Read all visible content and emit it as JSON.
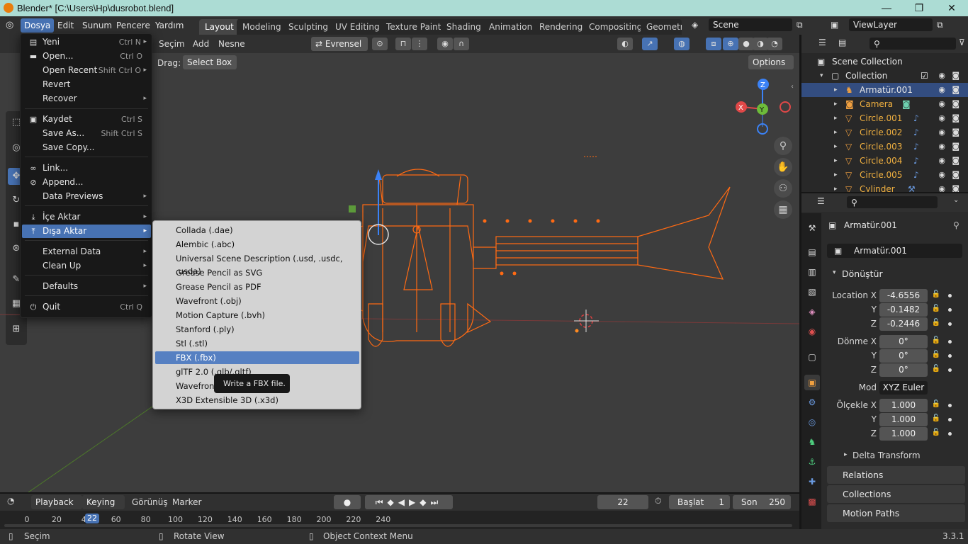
{
  "window": {
    "title": "Blender* [C:\\Users\\Hp\\dusrobot.blend]"
  },
  "menubar": {
    "items": [
      "Dosya",
      "Edit",
      "Sunum",
      "Pencere",
      "Yardım"
    ]
  },
  "workspaces": [
    "Layout",
    "Modeling",
    "Sculpting",
    "UV Editing",
    "Texture Paint",
    "Shading",
    "Animation",
    "Rendering",
    "Compositing",
    "Geometry"
  ],
  "scene": {
    "name": "Scene",
    "view_layer": "ViewLayer"
  },
  "viewport": {
    "header": {
      "menus": [
        "Seçim",
        "Add",
        "Nesne"
      ],
      "orientation": "Evrensel"
    },
    "drag_label": "Drag:",
    "drag_value": "Select Box",
    "options_label": "Options",
    "gizmo": {
      "x": "X",
      "y": "Y",
      "z": "Z"
    }
  },
  "file_menu": {
    "items": [
      {
        "label": "Yeni",
        "shortcut": "Ctrl N",
        "icon": "new-file-icon",
        "arrow": true
      },
      {
        "label": "Open...",
        "shortcut": "Ctrl O",
        "icon": "folder-icon"
      },
      {
        "label": "Open Recent",
        "shortcut": "Shift Ctrl O",
        "arrow": true
      },
      {
        "label": "Revert"
      },
      {
        "label": "Recover",
        "arrow": true
      },
      {
        "label": "Kaydet",
        "shortcut": "Ctrl S",
        "icon": "save-icon"
      },
      {
        "label": "Save As...",
        "shortcut": "Shift Ctrl S"
      },
      {
        "label": "Save Copy..."
      },
      {
        "label": "Link...",
        "icon": "link-icon"
      },
      {
        "label": "Append...",
        "icon": "append-icon"
      },
      {
        "label": "Data Previews",
        "arrow": true
      },
      {
        "label": "İçe Aktar",
        "icon": "import-icon",
        "arrow": true
      },
      {
        "label": "Dışa Aktar",
        "icon": "export-icon",
        "arrow": true
      },
      {
        "label": "External Data",
        "arrow": true
      },
      {
        "label": "Clean Up",
        "arrow": true
      },
      {
        "label": "Defaults",
        "arrow": true
      },
      {
        "label": "Quit",
        "shortcut": "Ctrl Q",
        "icon": "power-icon"
      }
    ]
  },
  "export_menu": {
    "items": [
      "Collada (.dae)",
      "Alembic (.abc)",
      "Universal Scene Description (.usd, .usdc, .usda)",
      "Grease Pencil as SVG",
      "Grease Pencil as PDF",
      "Wavefront (.obj)",
      "Motion Capture (.bvh)",
      "Stanford (.ply)",
      "Stl (.stl)",
      "FBX (.fbx)",
      "glTF 2.0 (.glb/.gltf)",
      "Wavefront (.obj)",
      "X3D Extensible 3D (.x3d)"
    ],
    "tooltip": "Write a FBX file."
  },
  "outliner": {
    "scene_collection": "Scene Collection",
    "collection": "Collection",
    "objects": [
      "Armatür.001",
      "Camera",
      "Circle.001",
      "Circle.002",
      "Circle.003",
      "Circle.004",
      "Circle.005",
      "Cylinder"
    ]
  },
  "properties": {
    "object_name": "Armatür.001",
    "object_field": "Armatür.001",
    "transform_header": "Dönüştür",
    "location_label": "Location X",
    "rotation_label": "Dönme X",
    "scale_label": "Ölçekle X",
    "y_label": "Y",
    "z_label": "Z",
    "location": [
      "-4.6556",
      "-0.1482",
      "-0.2446"
    ],
    "rotation": [
      "0°",
      "0°",
      "0°"
    ],
    "mode_label": "Mod",
    "mode": "XYZ Euler",
    "scale": [
      "1.000",
      "1.000",
      "1.000"
    ],
    "delta": "Delta Transform",
    "panels": [
      "Relations",
      "Collections",
      "Motion Paths"
    ]
  },
  "timeline": {
    "menus": [
      "Playback",
      "Keying",
      "Görünüş",
      "Marker"
    ],
    "current_frame": "22",
    "start_label": "Başlat",
    "start": "1",
    "end_label": "Son",
    "end": "250",
    "ticks": [
      "0",
      "20",
      "40",
      "60",
      "80",
      "100",
      "120",
      "140",
      "160",
      "180",
      "200",
      "220",
      "240"
    ]
  },
  "statusbar": {
    "select": "Seçim",
    "rotate": "Rotate View",
    "context": "Object Context Menu",
    "version": "3.3.1"
  }
}
